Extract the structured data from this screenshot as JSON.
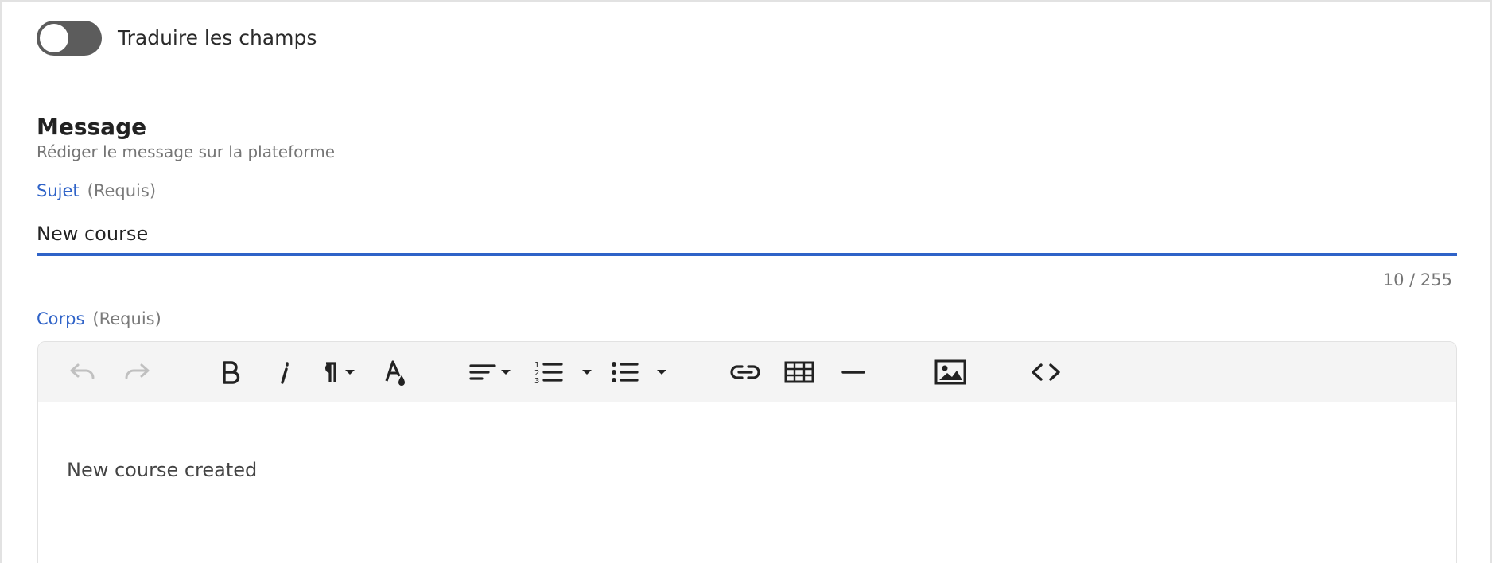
{
  "translate_toggle": {
    "label": "Traduire les champs",
    "checked": false
  },
  "section": {
    "title": "Message",
    "subtitle": "Rédiger le message sur la plateforme"
  },
  "subject": {
    "label": "Sujet",
    "required": "(Requis)",
    "value": "New course",
    "counter": "10 / 255"
  },
  "body": {
    "label": "Corps",
    "required": "(Requis)",
    "content": "New course created",
    "toolbar": [
      "undo-icon",
      "redo-icon",
      "bold-icon",
      "italic-icon",
      "paragraph-icon",
      "text-color-icon",
      "align-left-icon",
      "ordered-list-icon",
      "bullet-list-icon",
      "link-icon",
      "table-icon",
      "horizontal-rule-icon",
      "image-icon",
      "code-icon"
    ]
  },
  "colors": {
    "accent": "#2f63c8",
    "toggle_off": "#5c5c5c",
    "toolbar_bg": "#f4f4f4"
  }
}
